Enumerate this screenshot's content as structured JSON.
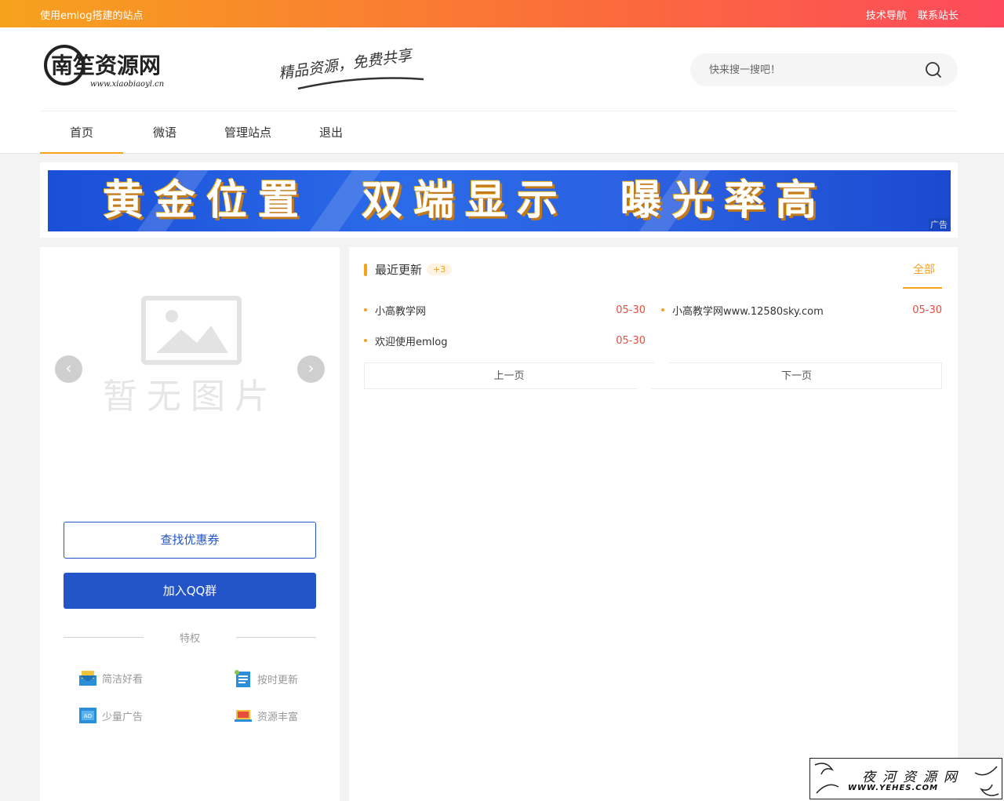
{
  "topbar": {
    "site_name": "使用emlog搭建的站点",
    "links": [
      "技术导航",
      "联系站长"
    ]
  },
  "header": {
    "logo_text": "南笙资源网",
    "logo_url_text": "www.xiaobiaoyl.cn",
    "slogan": "精品资源，免费共享",
    "search_placeholder": "快来搜一搜吧！"
  },
  "nav": {
    "items": [
      "首页",
      "微语",
      "管理站点",
      "退出"
    ],
    "active_index": 0
  },
  "banner": {
    "text": "黄金位置　双端显示　曝光率高",
    "ad_label": "广告"
  },
  "sidebar": {
    "placeholder_text": "暂无图片",
    "coupon_button": "查找优惠券",
    "qq_button": "加入QQ群",
    "privilege_title": "特权",
    "features": [
      "简洁好看",
      "按时更新",
      "少量广告",
      "资源丰富"
    ]
  },
  "recent": {
    "title": "最近更新",
    "badge": "+3",
    "all_link": "全部",
    "posts": [
      {
        "title": "小高教学网",
        "date": "05-30"
      },
      {
        "title": "小高教学网www.12580sky.com",
        "date": "05-30"
      },
      {
        "title": "欢迎使用emlog",
        "date": "05-30"
      }
    ],
    "prev_label": "上一页",
    "next_label": "下一页"
  },
  "watermark": {
    "title": "夜河资源网",
    "url": "WWW.YEHES.COM"
  },
  "colors": {
    "accent": "#f6a21d",
    "primary_blue": "#2354c8",
    "date_red": "#e84c3d"
  }
}
